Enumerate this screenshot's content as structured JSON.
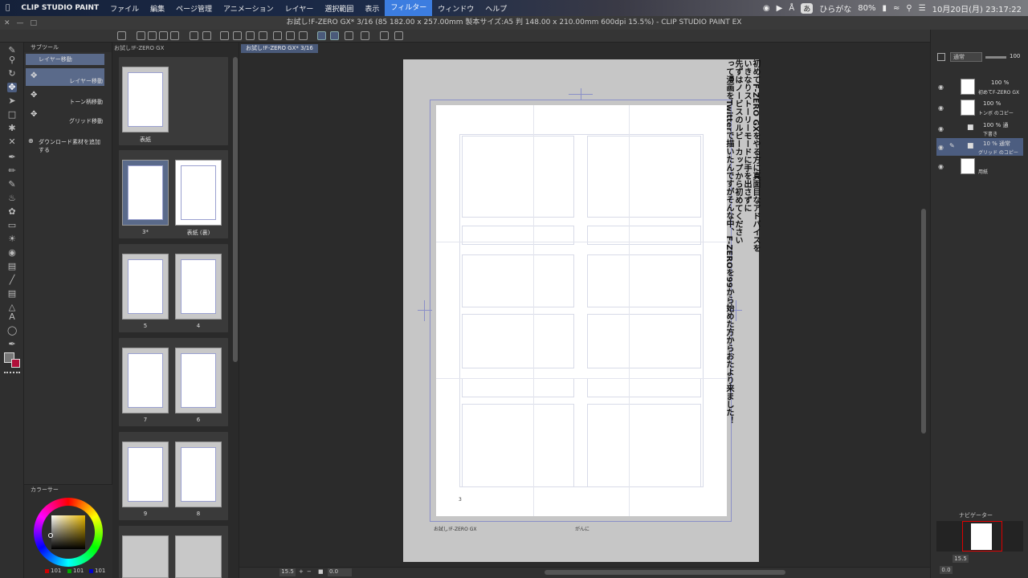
{
  "menubar": {
    "apple": "",
    "app_name": "CLIP STUDIO PAINT",
    "items": [
      "ファイル",
      "編集",
      "ページ管理",
      "アニメーション",
      "レイヤー",
      "選択範囲",
      "表示",
      "フィルター",
      "ウィンドウ",
      "ヘルプ"
    ],
    "active_item": "フィルター",
    "input_method": "あ",
    "input_label": "ひらがな",
    "battery": "80%",
    "datetime": "10月20日(月) 23:17:22"
  },
  "window": {
    "title": "お試し!F-ZERO GX* 3/16 (85 182.00 x 257.00mm 製本サイズ:A5 判 148.00 x 210.00mm 600dpi 15.5%) - CLIP STUDIO PAINT EX"
  },
  "subtool": {
    "header": "サブツール",
    "items": [
      "レイヤー移動",
      "レイヤー移動",
      "トーン柄移動",
      "グリッド移動"
    ],
    "add_material": "ダウンロード素材を追加する"
  },
  "color": {
    "header": "カラーサー",
    "r": "101",
    "g": "101",
    "b": "101",
    "main_color": "#8a8a8a",
    "sub_color": "#b0103a"
  },
  "pagelist": {
    "tab": "お試し!F-ZERO GX",
    "pages": [
      {
        "label": "表紙"
      },
      {
        "label": "3*"
      },
      {
        "label": "表紙 (裏)"
      },
      {
        "label": "5"
      },
      {
        "label": "4"
      },
      {
        "label": "7"
      },
      {
        "label": "6"
      },
      {
        "label": "9"
      },
      {
        "label": "8"
      }
    ]
  },
  "canvas": {
    "doc_tab": "お試し!F-ZERO GX* 3/16",
    "side_text": [
      "初めてF-ZERO GXをやる方に真面目なアドバイスを",
      "いきなりストーリーモードに手を出さずに",
      "先ずはノービスのルビーカップから初めてください",
      "って漫画をTwitterで描いたんですがそんな中、F-ZEROを99から始めた方からおたより来ました！"
    ],
    "page_number": "3",
    "footer_left": "お試し!F-ZERO GX",
    "footer_center": "がんに"
  },
  "layers": {
    "blend_mode": "通常",
    "opacity": "100",
    "items": [
      {
        "pct": "100 %",
        "name": "初めてF-ZERO GX"
      },
      {
        "pct": "100 %",
        "name": "トンボ のコピー"
      },
      {
        "pct": "100 % 通",
        "name": "下書き"
      },
      {
        "pct": "10 % 通常",
        "name": "グリッド のコピー"
      },
      {
        "pct": "",
        "name": "用紙"
      }
    ]
  },
  "navigator": {
    "header": "ナビゲーター",
    "zoom": "15.5",
    "rotation": "0.0"
  },
  "bottom": {
    "zoom": "15.5",
    "rotation": "0.0"
  }
}
